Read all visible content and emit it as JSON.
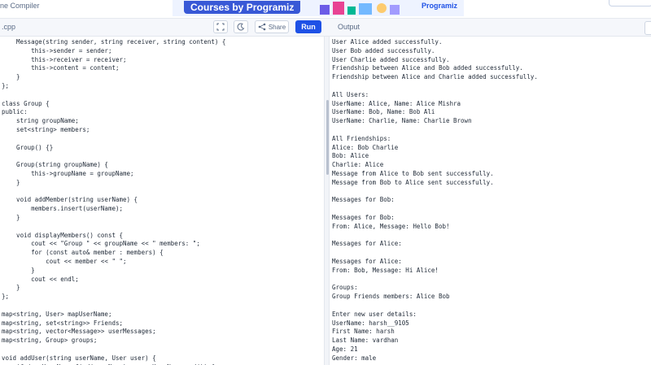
{
  "top": {
    "brand_text": "ne Compiler",
    "banner_title": "Courses by Programiz",
    "banner_brand": "Programiz"
  },
  "toolbar": {
    "file_tab": ".cpp",
    "share_label": "Share",
    "run_label": "Run",
    "output_label": "Output"
  },
  "icons": [
    "fullscreen-icon",
    "dark-mode-icon",
    "share-icon"
  ],
  "editor": {
    "lines": [
      "    Message(string sender, string receiver, string content) {",
      "        this->sender = sender;",
      "        this->receiver = receiver;",
      "        this->content = content;",
      "    }",
      "};",
      "",
      "class Group {",
      "public:",
      "    string groupName;",
      "    set<string> members;",
      "",
      "    Group() {}",
      "",
      "    Group(string groupName) {",
      "        this->groupName = groupName;",
      "    }",
      "",
      "    void addMember(string userName) {",
      "        members.insert(userName);",
      "    }",
      "",
      "    void displayMembers() const {",
      "        cout << \"Group \" << groupName << \" members: \";",
      "        for (const auto& member : members) {",
      "            cout << member << \" \";",
      "        }",
      "        cout << endl;",
      "    }",
      "};",
      "",
      "map<string, User> mapUserName;",
      "map<string, set<string>> Friends;",
      "map<string, vector<Message>> userMessages;",
      "map<string, Group> groups;",
      "",
      "void addUser(string userName, User user) {",
      "    if (mapUserName.find(userName) == mapUserName.end()) {"
    ]
  },
  "output": {
    "lines": [
      "User Alice added successfully.",
      "User Bob added successfully.",
      "User Charlie added successfully.",
      "Friendship between Alice and Bob added successfully.",
      "Friendship between Alice and Charlie added successfully.",
      "",
      "All Users:",
      "UserName: Alice, Name: Alice Mishra",
      "UserName: Bob, Name: Bob Ali",
      "UserName: Charlie, Name: Charlie Brown",
      "",
      "All Friendships:",
      "Alice: Bob Charlie",
      "Bob: Alice",
      "Charlie: Alice",
      "Message from Alice to Bob sent successfully.",
      "Message from Bob to Alice sent successfully.",
      "",
      "Messages for Bob:",
      "",
      "Messages for Bob:",
      "From: Alice, Message: Hello Bob!",
      "",
      "Messages for Alice:",
      "",
      "Messages for Alice:",
      "From: Bob, Message: Hi Alice!",
      "",
      "Groups:",
      "Group Friends members: Alice Bob",
      "",
      "Enter new user details:",
      "UserName: harsh__9105",
      "First Name: harsh",
      "Last Name: vardhan",
      "Age: 21",
      "Gender: male"
    ]
  }
}
